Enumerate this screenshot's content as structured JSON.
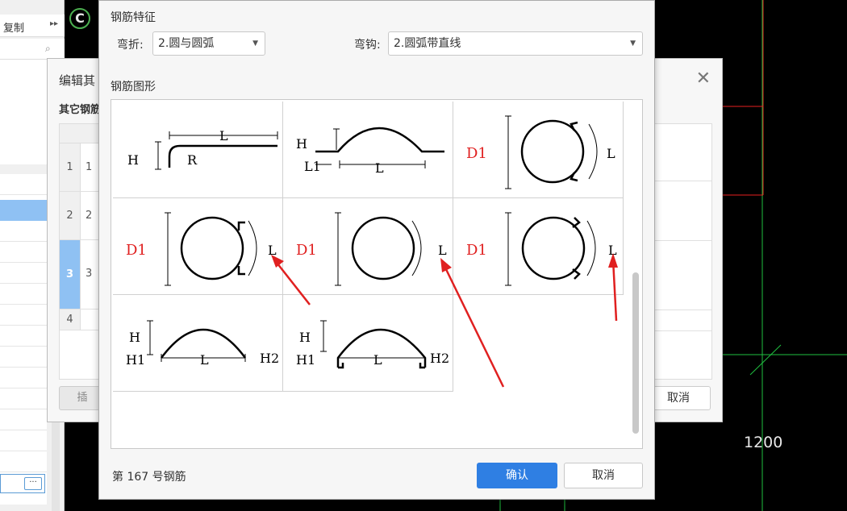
{
  "cad": {
    "dimension_label": "1200",
    "circle_letter": "C"
  },
  "left_panel": {
    "copy_label": "复制",
    "more_icon": "double-chevron-right-icon",
    "search_icon": "search-icon",
    "dots_label": "···"
  },
  "middle_dialog": {
    "title": "编辑其",
    "subtitle": "其它钢筋",
    "rows": [
      {
        "num": "1",
        "value": "1"
      },
      {
        "num": "2",
        "value": "2"
      },
      {
        "num": "3",
        "value": "3"
      },
      {
        "num": "4",
        "value": ""
      }
    ],
    "insert_label": "插",
    "cancel_label": "取消",
    "close_icon": "close-icon"
  },
  "dialog": {
    "feature_section": "钢筋特征",
    "bend_label": "弯折:",
    "bend_value": "2.圆与圆弧",
    "hook_label": "弯钩:",
    "hook_value": "2.圆弧带直线",
    "shape_section": "钢筋图形",
    "footer_text": "第 167 号钢筋",
    "ok_label": "确认",
    "cancel_label": "取消"
  },
  "shapes": {
    "cell1": {
      "h": "H",
      "l": "L",
      "r": "R"
    },
    "cell2": {
      "h": "H",
      "l1": "L1",
      "l": "L"
    },
    "cell3": {
      "d1": "D1",
      "l": "L"
    },
    "cell4": {
      "d1": "D1",
      "l": "L"
    },
    "cell5": {
      "d1": "D1",
      "l": "L"
    },
    "cell6": {
      "d1": "D1",
      "l": "L"
    },
    "cell7": {
      "h": "H",
      "h1": "H1",
      "l": "L",
      "h2": "H2"
    },
    "cell8": {
      "h": "H",
      "h1": "H1",
      "l": "L",
      "h2": "H2"
    }
  },
  "colors": {
    "accent": "#2f7fe3",
    "annotation_red": "#e02020",
    "selected_row": "#8fc1f3"
  }
}
